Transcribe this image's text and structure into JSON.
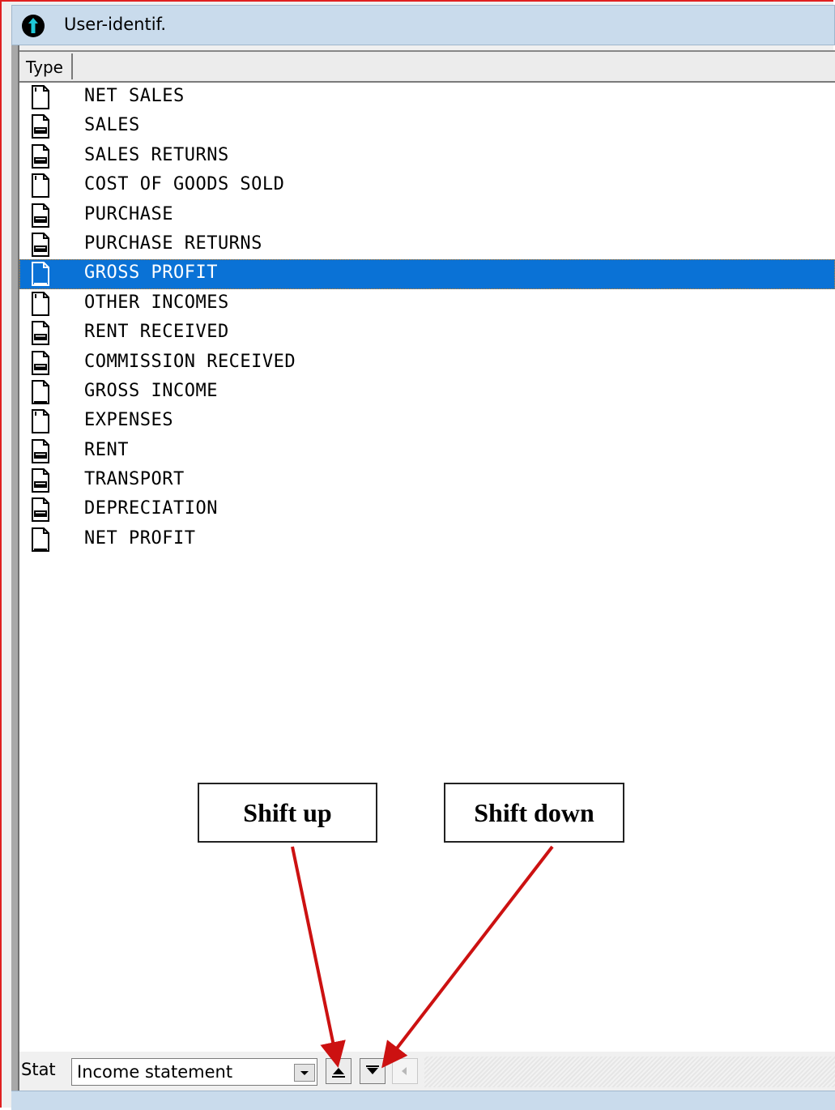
{
  "window": {
    "title": "User-identif.",
    "title_icon": "info-arrow-icon"
  },
  "list": {
    "column_header": "Type",
    "selected_index": 6,
    "items": [
      {
        "label": "NET SALES",
        "icon": "document-outline-icon"
      },
      {
        "label": "SALES",
        "icon": "document-filled-icon"
      },
      {
        "label": "SALES RETURNS",
        "icon": "document-filled-icon"
      },
      {
        "label": "COST OF GOODS SOLD",
        "icon": "document-outline-icon"
      },
      {
        "label": "PURCHASE",
        "icon": "document-filled-icon"
      },
      {
        "label": "PURCHASE RETURNS",
        "icon": "document-filled-icon"
      },
      {
        "label": "GROSS PROFIT",
        "icon": "document-underline-icon"
      },
      {
        "label": "OTHER INCOMES",
        "icon": "document-outline-icon"
      },
      {
        "label": "RENT RECEIVED",
        "icon": "document-filled-icon"
      },
      {
        "label": "COMMISSION RECEIVED",
        "icon": "document-filled-icon"
      },
      {
        "label": "GROSS INCOME",
        "icon": "document-underline-icon"
      },
      {
        "label": "EXPENSES",
        "icon": "document-outline-icon"
      },
      {
        "label": "RENT",
        "icon": "document-filled-icon"
      },
      {
        "label": "TRANSPORT",
        "icon": "document-filled-icon"
      },
      {
        "label": "DEPRECIATION",
        "icon": "document-filled-icon"
      },
      {
        "label": "NET PROFIT",
        "icon": "document-underline-icon"
      }
    ]
  },
  "annotations": {
    "shift_up": "Shift up",
    "shift_down": "Shift down"
  },
  "bottom": {
    "stat_label": "Stat",
    "combo_value": "Income statement",
    "move_up_icon": "triangle-up-icon",
    "move_down_icon": "triangle-down-icon",
    "scroll_left_icon": "triangle-left-icon"
  },
  "colors": {
    "selection": "#0a72d6",
    "titlebar": "#c9dbec",
    "annotation_arrow": "#cc1111"
  }
}
